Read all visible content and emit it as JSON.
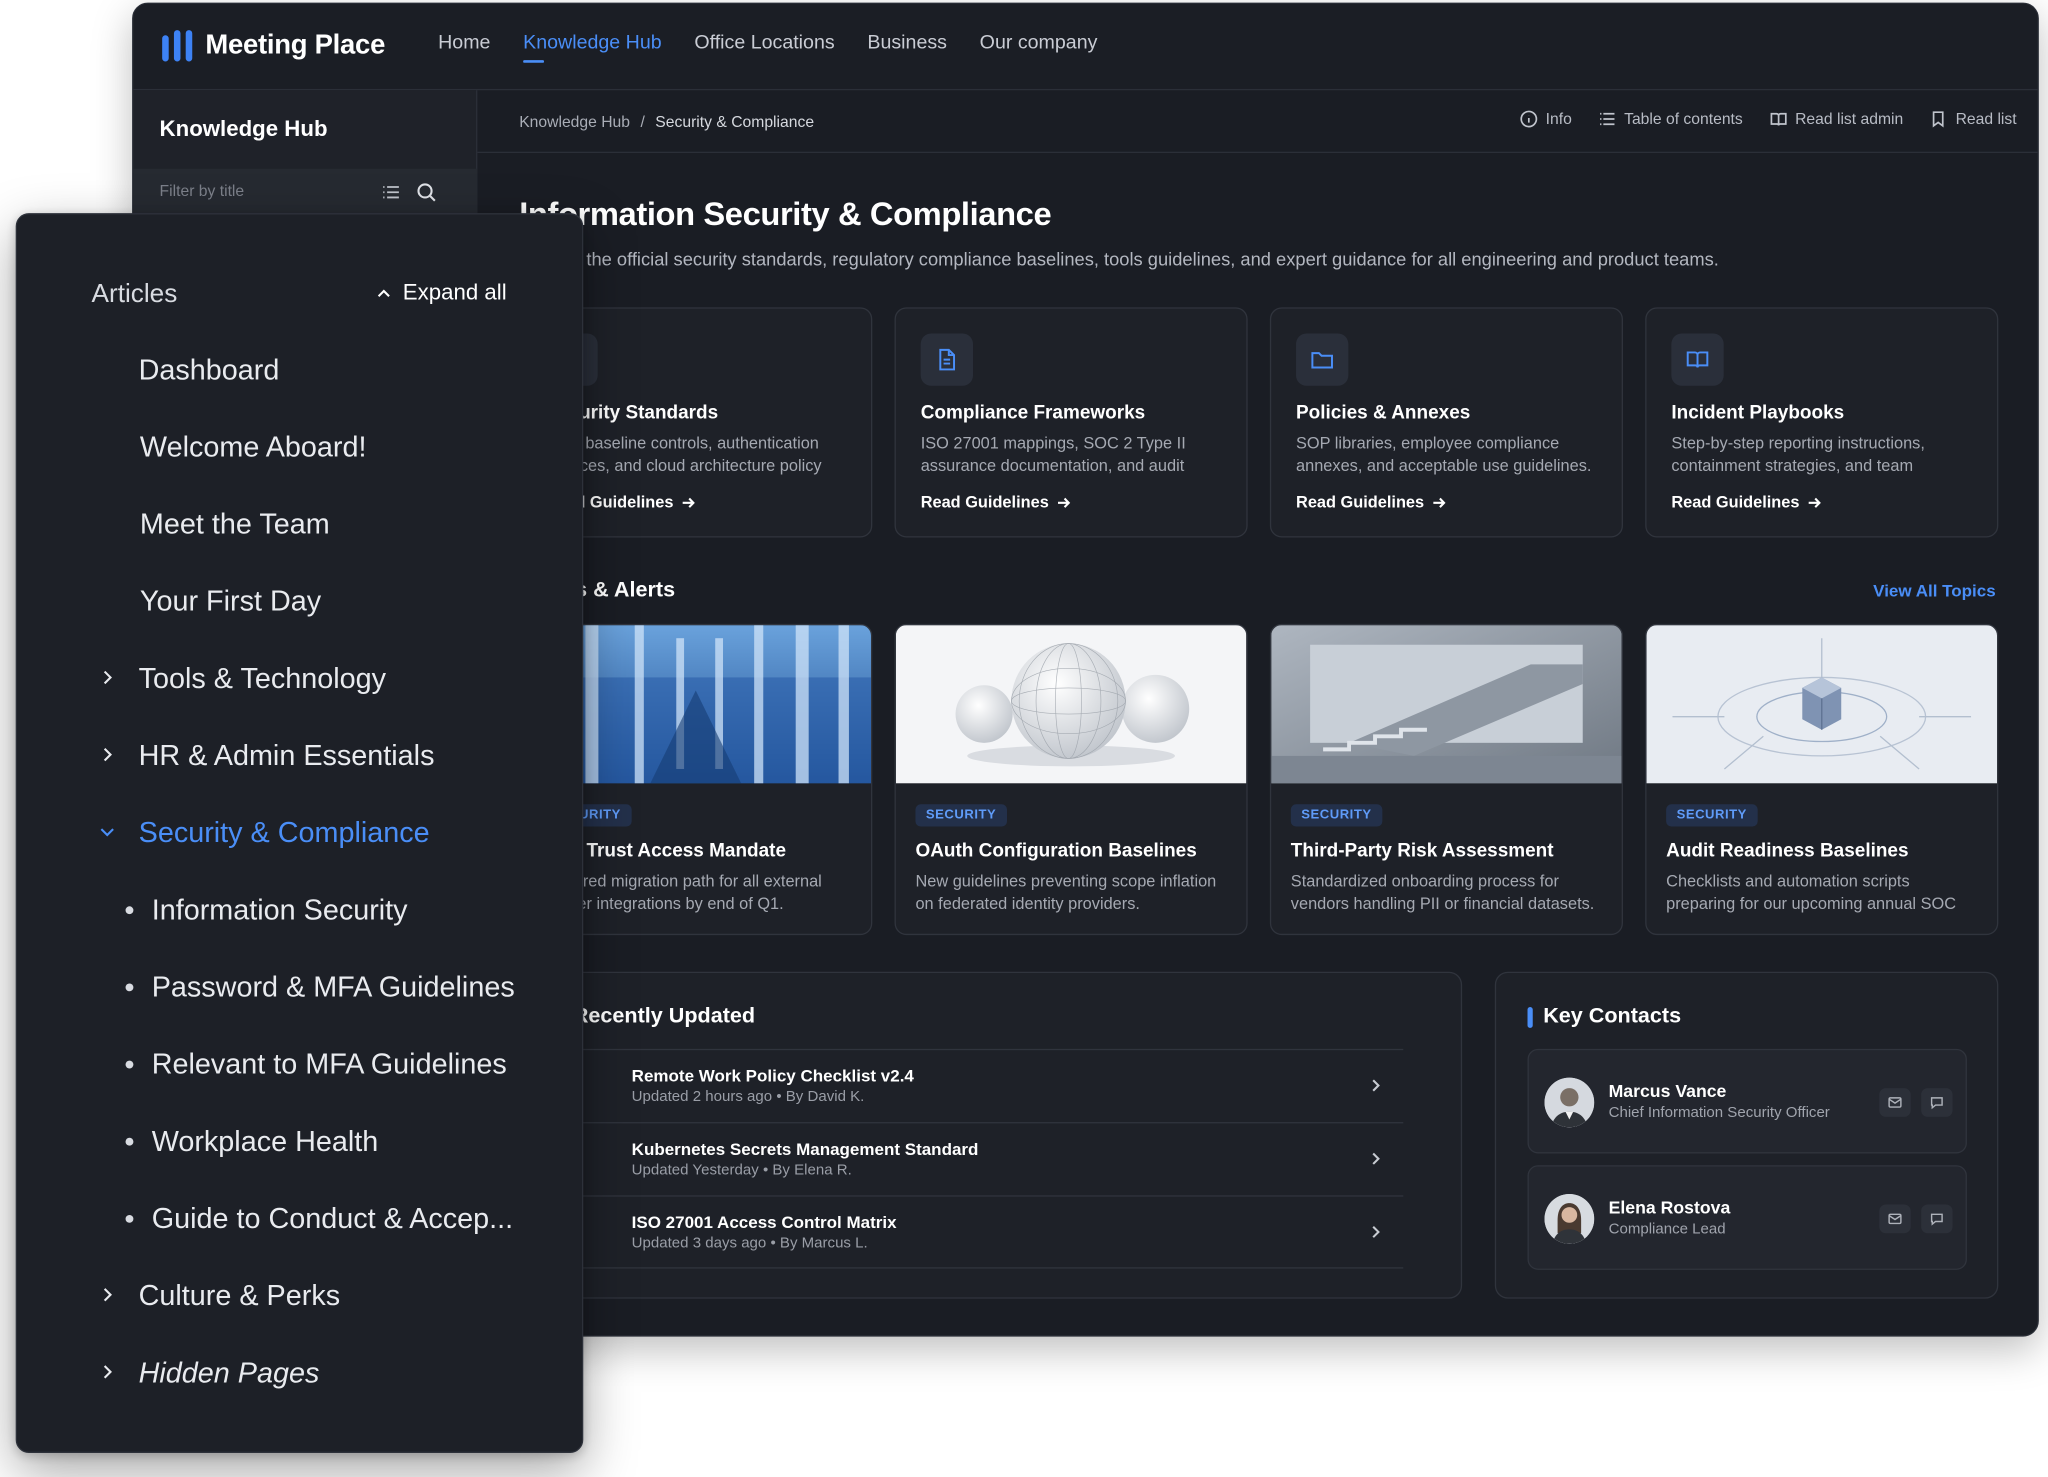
{
  "app": {
    "name": "Meeting Place",
    "nav": [
      {
        "label": "Home",
        "active": false
      },
      {
        "label": "Knowledge Hub",
        "active": true
      },
      {
        "label": "Office Locations",
        "active": false
      },
      {
        "label": "Business",
        "active": false
      },
      {
        "label": "Our company",
        "active": false
      }
    ],
    "accent": "#4a8ef7"
  },
  "left_panel": {
    "title": "Knowledge Hub",
    "filter_placeholder": "Filter by title"
  },
  "breadcrumb": {
    "root": "Knowledge Hub",
    "sep": "/",
    "current": "Security & Compliance"
  },
  "actions": {
    "info": "Info",
    "toc": "Table of contents",
    "read_list_admin": "Read list admin",
    "read_list": "Read list"
  },
  "page": {
    "title": "Information Security & Compliance",
    "subtitle": "Explore the official security standards, regulatory compliance baselines, tools guidelines, and expert guidance for all engineering and product teams."
  },
  "categories": [
    {
      "title": "Security Standards",
      "desc": "Core baseline controls, authentication services, and cloud architecture policy requirements.",
      "link": "Read Guidelines",
      "icon": "shield-icon"
    },
    {
      "title": "Compliance Frameworks",
      "desc": "ISO 27001 mappings, SOC 2 Type II assurance documentation, and audit checklists.",
      "link": "Read Guidelines",
      "icon": "document-icon"
    },
    {
      "title": "Policies & Annexes",
      "desc": "SOP libraries, employee compliance annexes, and acceptable use guidelines.",
      "link": "Read Guidelines",
      "icon": "folder-icon"
    },
    {
      "title": "Incident Playbooks",
      "desc": "Step-by-step reporting instructions, containment strategies, and team escalation paths.",
      "link": "Read Guidelines",
      "icon": "book-icon"
    }
  ],
  "topics": {
    "title": "Topics & Alerts",
    "view_all": "View All Topics",
    "items": [
      {
        "tag": "SECURITY",
        "title": "Zero Trust Access Mandate",
        "desc": "Required migration path for all external partner integrations by end of Q1."
      },
      {
        "tag": "SECURITY",
        "title": "OAuth Configuration Baselines",
        "desc": "New guidelines preventing scope inflation on federated identity providers."
      },
      {
        "tag": "SECURITY",
        "title": "Third-Party Risk Assessment",
        "desc": "Standardized onboarding process for vendors handling PII or financial datasets."
      },
      {
        "tag": "SECURITY",
        "title": "Audit Readiness Baselines",
        "desc": "Checklists and automation scripts preparing for our upcoming annual SOC audit."
      }
    ]
  },
  "recent": {
    "title": "Recently Updated",
    "items": [
      {
        "title": "Remote Work Policy Checklist v2.4",
        "meta": "Updated 2 hours ago • By David K."
      },
      {
        "title": "Kubernetes Secrets Management Standard",
        "meta": "Updated Yesterday • By Elena R."
      },
      {
        "title": "ISO 27001 Access Control Matrix",
        "meta": "Updated 3 days ago • By Marcus L."
      }
    ]
  },
  "contacts": {
    "title": "Key Contacts",
    "items": [
      {
        "name": "Marcus Vance",
        "role": "Chief Information Security Officer"
      },
      {
        "name": "Elena Rostova",
        "role": "Compliance Lead"
      }
    ]
  },
  "sidebar": {
    "heading": "Articles",
    "expand_all": "Expand all",
    "items": [
      {
        "label": "Dashboard",
        "type": "page"
      },
      {
        "label": "Welcome Aboard!",
        "type": "page"
      },
      {
        "label": "Meet the Team",
        "type": "page"
      },
      {
        "label": "Your First Day",
        "type": "page"
      },
      {
        "label": "Tools & Technology",
        "type": "collapsed"
      },
      {
        "label": "HR & Admin Essentials",
        "type": "collapsed"
      },
      {
        "label": "Security & Compliance",
        "type": "expanded"
      },
      {
        "label": "Information Security",
        "type": "child"
      },
      {
        "label": "Password & MFA Guidelines",
        "type": "child"
      },
      {
        "label": "Relevant to MFA Guidelines",
        "type": "child"
      },
      {
        "label": "Workplace Health",
        "type": "child"
      },
      {
        "label": "Guide to Conduct & Accep...",
        "type": "child"
      },
      {
        "label": "Culture & Perks",
        "type": "collapsed"
      },
      {
        "label": "Hidden Pages",
        "type": "collapsed"
      }
    ]
  }
}
